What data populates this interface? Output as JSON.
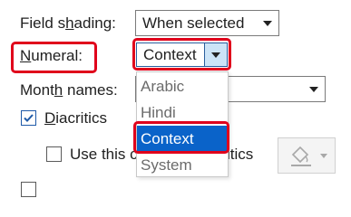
{
  "field_shading": {
    "label_pre": "Field s",
    "label_hot": "h",
    "label_post": "ading:",
    "value": "When selected"
  },
  "numeral": {
    "label_hot": "N",
    "label_post": "umeral:",
    "value": "Context"
  },
  "month_names": {
    "label_pre": "Mont",
    "label_hot": "h",
    "label_post": " names:"
  },
  "diacritics": {
    "label_hot": "D",
    "label_post": "iacritics",
    "checked": true
  },
  "use_this_color": {
    "label_left": "Use this c",
    "label_right": "itics",
    "checked": false
  },
  "numeral_dropdown": {
    "options": [
      "Arabic",
      "Hindi",
      "Context",
      "System"
    ],
    "selected_index": 2
  },
  "colors": {
    "highlight": "#e0001b",
    "selection": "#0a63c9",
    "accent": "#1e5aa8"
  },
  "icons": {
    "dropdown": "chevron-down-icon",
    "check": "checkmark-icon",
    "paint": "paint-bucket-icon"
  }
}
